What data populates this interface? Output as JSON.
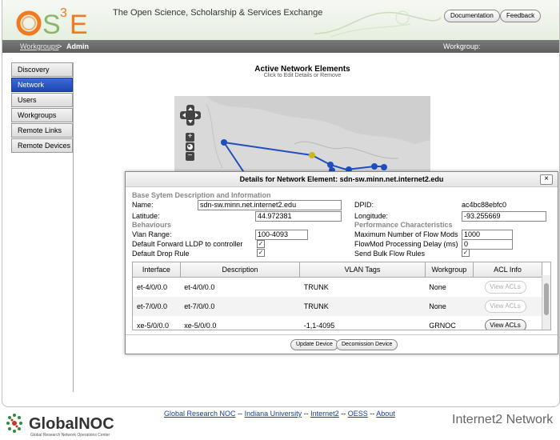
{
  "header": {
    "logo_text": "OS3E",
    "site_title": "The Open Science, Scholarship & Services Exchange",
    "documentation_label": "Documentation",
    "feedback_label": "Feedback"
  },
  "subnav": {
    "breadcrumb_link": "Workgroups",
    "breadcrumb_sep": ">",
    "breadcrumb_current": "Admin",
    "workgroup_label": "Workgroup:"
  },
  "sidebar": {
    "items": [
      {
        "label": "Discovery"
      },
      {
        "label": "Network"
      },
      {
        "label": "Users"
      },
      {
        "label": "Workgroups"
      },
      {
        "label": "Remote Links"
      },
      {
        "label": "Remote Devices"
      }
    ]
  },
  "main": {
    "title": "Active Network Elements",
    "subtitle": "Click to Edit Details or Remove"
  },
  "dialog": {
    "title": "Details for Network Element: sdn-sw.minn.net.internet2.edu",
    "close_label": "×",
    "base_section": "Base Sytem Description and Information",
    "name_label": "Name:",
    "name_value": "sdn-sw.minn.net.internet2.edu",
    "dpid_label": "DPID:",
    "dpid_value": "ac4bc88ebfc0",
    "latitude_label": "Latitude:",
    "latitude_value": "44.972381",
    "longitude_label": "Longitude:",
    "longitude_value": "-93.255669",
    "behaviours_section": "Behaviours",
    "perf_section": "Performance Characteristics",
    "vlan_label": "Vlan Range:",
    "vlan_value": "100-4093",
    "max_flow_label": "Maximum Number of Flow Mods",
    "max_flow_value": "1000",
    "lldp_label": "Default Forward LLDP to controller",
    "flowmod_delay_label": "FlowMod Processing Delay (ms)",
    "flowmod_delay_value": "0",
    "drop_rule_label": "Default Drop Rule",
    "bulk_flow_label": "Send Bulk Flow Rules",
    "check_glyph": "✓",
    "columns": [
      "Interface",
      "Description",
      "VLAN Tags",
      "Workgroup",
      "ACL Info"
    ],
    "rows": [
      {
        "interface": "et-4/0/0.0",
        "description": "et-4/0/0.0",
        "vlan": "TRUNK",
        "workgroup": "None",
        "acl": "View ACLs"
      },
      {
        "interface": "et-7/0/0.0",
        "description": "et-7/0/0.0",
        "vlan": "TRUNK",
        "workgroup": "None",
        "acl": "View ACLs"
      },
      {
        "interface": "xe-5/0/0.0",
        "description": "xe-5/0/0.0",
        "vlan": "-1,1-4095",
        "workgroup": "GRNOC",
        "acl": "View ACLs"
      }
    ],
    "update_label": "Update Device",
    "decommission_label": "Decomission Device"
  },
  "map": {
    "zoom_in": "+",
    "zoom_out": "−"
  },
  "footer": {
    "links": [
      "Global Research NOC",
      "Indiana University",
      "Internet2",
      "OESS",
      "About"
    ],
    "separator": "--",
    "globalnoc_name": "GlobalNOC",
    "globalnoc_tagline": "Global Research Network Operations Center",
    "internet2_text": "Internet2 Network"
  },
  "colors": {
    "accent_blue": "#1d46b0",
    "logo_orange": "#f07a1e",
    "logo_green": "#8ab86a",
    "node_blue": "#1f4fbf",
    "node_yellow": "#c9b81a"
  }
}
